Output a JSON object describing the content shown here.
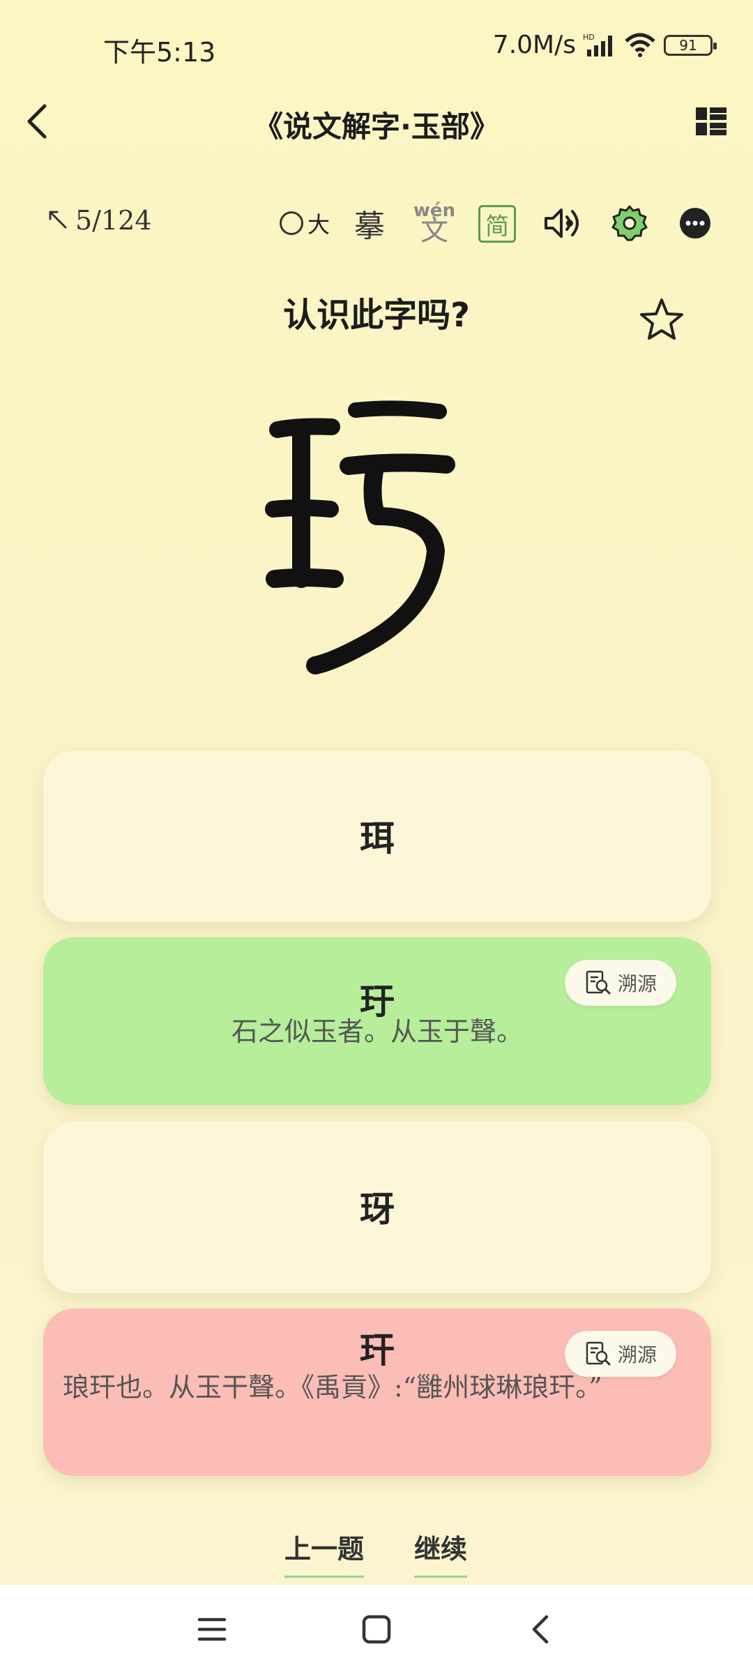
{
  "status_bar": {
    "time": "下午5:13",
    "network_speed": "7.0M/s",
    "signal_badge": "HD",
    "battery": "91"
  },
  "header": {
    "title": "《说文解字·玉部》"
  },
  "toolbar": {
    "progress": "5/124",
    "size_label": "大",
    "moqi_label": "摹",
    "pinyin_label": "wén",
    "pinyin_char": "文",
    "simplified_label": "简"
  },
  "question": {
    "prompt": "认识此字吗?"
  },
  "options": [
    {
      "char": "珥",
      "definition": "",
      "state": "neutral"
    },
    {
      "char": "玗",
      "definition": "石之似玉者。从玉于聲。",
      "state": "correct",
      "source_label": "溯源"
    },
    {
      "char": "玡",
      "definition": "",
      "state": "neutral"
    },
    {
      "char": "玕",
      "definition": "琅玕也。从玉干聲。《禹貢》:“雝州球琳琅玕。”",
      "state": "wrong",
      "source_label": "溯源"
    }
  ],
  "footer": {
    "prev_label": "上一题",
    "next_label": "继续"
  },
  "colors": {
    "correct": "#b6ee9a",
    "wrong": "#fbbdb6",
    "neutral": "#fcf6d8",
    "accent": "#5a9a5a"
  }
}
